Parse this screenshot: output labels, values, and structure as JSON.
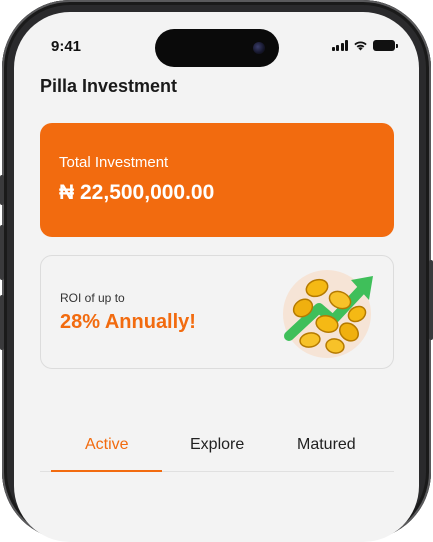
{
  "status_bar": {
    "time": "9:41"
  },
  "header": {
    "title": "Pilla Investment"
  },
  "investment_card": {
    "label": "Total Investment",
    "amount": "₦ 22,500,000.00"
  },
  "roi_card": {
    "label": "ROI of up to",
    "value": "28% Annually!",
    "illustration_icon": "coins-growth-icon"
  },
  "tabs": [
    {
      "label": "Active",
      "active": true
    },
    {
      "label": "Explore",
      "active": false
    },
    {
      "label": "Matured",
      "active": false
    }
  ],
  "colors": {
    "accent": "#f26b0f",
    "background": "#f3f3f3",
    "text": "#1a1a1a"
  }
}
